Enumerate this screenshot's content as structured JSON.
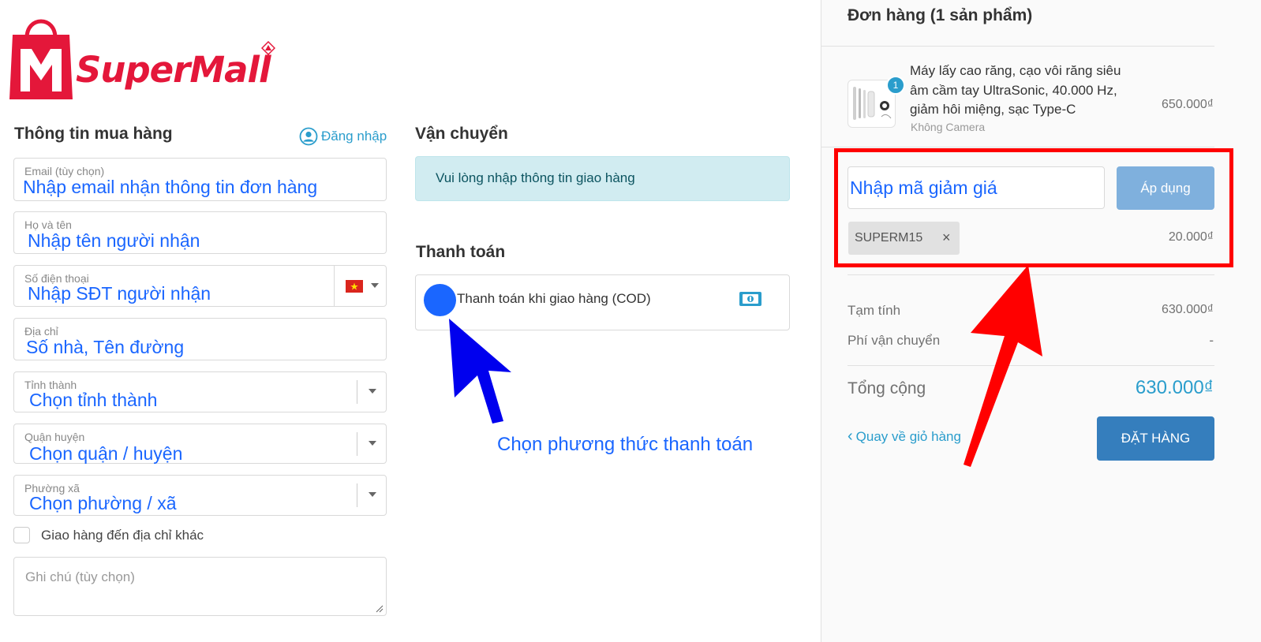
{
  "brand": {
    "name": "SuperMall",
    "logo_letter": "M"
  },
  "customer": {
    "title": "Thông tin mua hàng",
    "login_label": "Đăng nhập",
    "email": {
      "label": "Email (tùy chọn)",
      "value": "Nhập email nhận thông tin đơn hàng"
    },
    "name": {
      "label": "Họ và tên",
      "value": "Nhập tên người nhận"
    },
    "phone": {
      "label": "Số điện thoại",
      "value": "Nhập SĐT người nhận"
    },
    "address": {
      "label": "Địa chỉ",
      "value": "Số nhà, Tên đường"
    },
    "province": {
      "label": "Tỉnh thành",
      "value": "Chọn tỉnh thành"
    },
    "district": {
      "label": "Quận huyện",
      "value": "Chọn quận / huyện"
    },
    "ward": {
      "label": "Phường xã",
      "value": "Chọn phường / xã"
    },
    "ship_other_label": "Giao hàng đến địa chỉ khác",
    "note_placeholder": "Ghi chú (tùy chọn)"
  },
  "shipping": {
    "title": "Vận chuyển",
    "notice": "Vui lòng nhập thông tin giao hàng"
  },
  "payment": {
    "title": "Thanh toán",
    "method_label": "Thanh toán khi giao hàng (COD)",
    "annotation": "Chọn phương thức thanh toán"
  },
  "order": {
    "title": "Đơn hàng (1 sản phẩm)",
    "item": {
      "quantity": "1",
      "name_line1": "Máy lấy cao răng, cạo vôi răng siêu",
      "name_line2": "âm cầm tay UltraSonic, 40.000 Hz,",
      "name_line3": "giảm hôi miệng, sạc Type-C",
      "variant": "Không Camera",
      "price": "650.000₫"
    },
    "discount_value": "Nhập mã giảm giá",
    "apply_label": "Áp dụng",
    "coupon_code": "SUPERM15",
    "coupon_remove": "×",
    "coupon_amount": "20.000₫",
    "subtotal_label": "Tạm tính",
    "subtotal_value": "630.000₫",
    "shipping_label": "Phí vận chuyển",
    "shipping_value": "-",
    "total_label": "Tổng cộng",
    "total_value": "630.000₫",
    "back_label": "Quay về giỏ hàng",
    "back_chevron": "‹",
    "order_button": "ĐẶT HÀNG"
  },
  "colors": {
    "brand_red": "#e4173a",
    "link_blue": "#2a9dcc",
    "annotation_blue": "#1a66ff",
    "highlight_red": "#ff0000",
    "order_button": "#357ebd",
    "apply_button": "#7fb0dd"
  },
  "icons": [
    "shopping-bag-icon",
    "user-circle-icon",
    "vietnam-flag-icon",
    "cash-icon",
    "chevron-left-icon"
  ]
}
